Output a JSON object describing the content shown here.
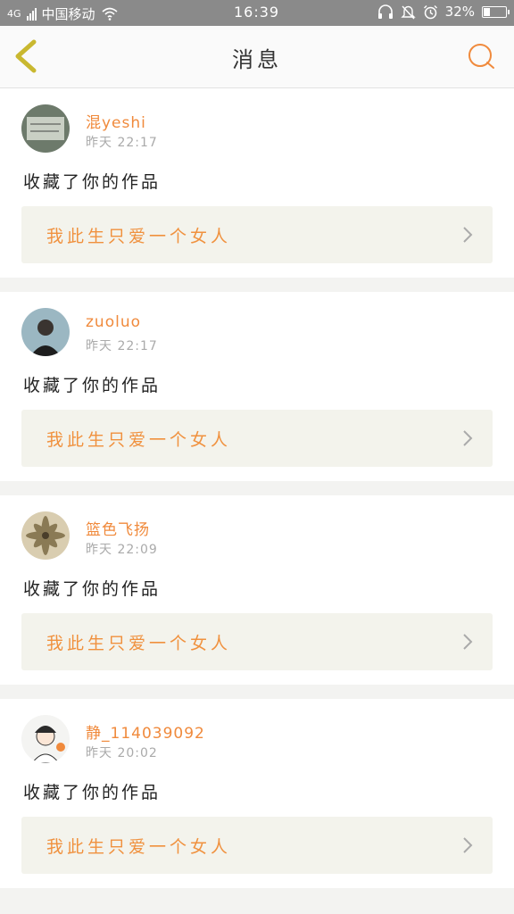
{
  "status": {
    "signal_text": "4G",
    "carrier": "中国移动",
    "time": "16:39",
    "battery": "32%",
    "battery_level": 0.32
  },
  "header": {
    "title": "消息"
  },
  "messages": [
    {
      "user": "混yeshi",
      "time": "昨天 22:17",
      "action": "收藏了你的作品",
      "work": "我此生只爱一个女人"
    },
    {
      "user": "zuoluo",
      "time": "昨天 22:17",
      "action": "收藏了你的作品",
      "work": "我此生只爱一个女人"
    },
    {
      "user": "篮色飞扬",
      "time": "昨天 22:09",
      "action": "收藏了你的作品",
      "work": "我此生只爱一个女人"
    },
    {
      "user": "静_114039092",
      "time": "昨天 20:02",
      "action": "收藏了你的作品",
      "work": "我此生只爱一个女人"
    }
  ],
  "colors": {
    "accent": "#f08a3c",
    "back_arrow": "#c9b830",
    "status_bar": "#8a8a8a"
  }
}
